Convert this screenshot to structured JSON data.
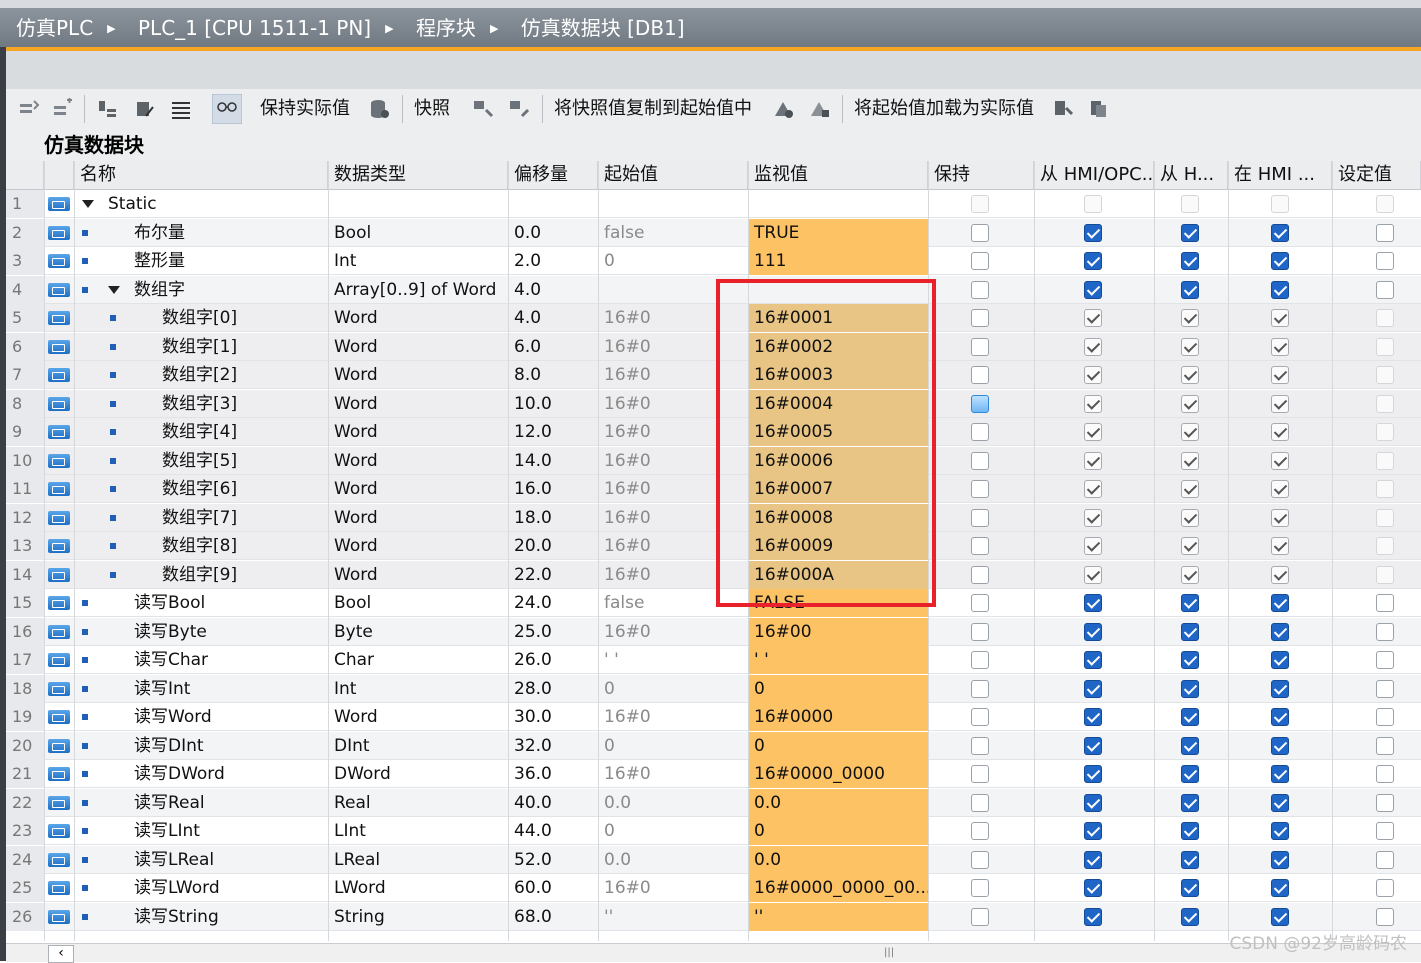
{
  "breadcrumb": [
    "仿真PLC",
    "PLC_1 [CPU 1511-1 PN]",
    "程序块",
    "仿真数据块 [DB1]"
  ],
  "toolbar": {
    "keep_actual": "保持实际值",
    "snapshot": "快照",
    "copy_snapshot_to_start": "将快照值复制到起始值中",
    "load_start_as_actual": "将起始值加载为实际值"
  },
  "block_title": "仿真数据块",
  "columns": {
    "name": "名称",
    "datatype": "数据类型",
    "offset": "偏移量",
    "start": "起始值",
    "monitor": "监视值",
    "retain": "保持",
    "from_hmi": "从 HMI/OPC...",
    "from_h": "从 H...",
    "in_hmi": "在 HMI ...",
    "setpoint": "设定值"
  },
  "rows": [
    {
      "n": "1",
      "name": "Static",
      "type": "",
      "offset": "",
      "start": "",
      "monitor": "",
      "level": 0,
      "expander": true,
      "group": true,
      "cb": [
        "faint",
        "faint",
        "faint",
        "faint",
        "faint"
      ]
    },
    {
      "n": "2",
      "name": "布尔量",
      "type": "Bool",
      "offset": "0.0",
      "start": "false",
      "monitor": "TRUE",
      "level": 1,
      "cb": [
        "none",
        "checked",
        "checked",
        "checked",
        "none"
      ]
    },
    {
      "n": "3",
      "name": "整形量",
      "type": "Int",
      "offset": "2.0",
      "start": "0",
      "monitor": "111",
      "level": 1,
      "cb": [
        "none",
        "checked",
        "checked",
        "checked",
        "none"
      ]
    },
    {
      "n": "4",
      "name": "数组字",
      "type": "Array[0..9] of Word",
      "offset": "4.0",
      "start": "",
      "monitor": "",
      "level": 1,
      "expander": true,
      "group": true,
      "cb": [
        "none",
        "checked",
        "checked",
        "checked",
        "none"
      ]
    },
    {
      "n": "5",
      "name": "数组字[0]",
      "type": "Word",
      "offset": "4.0",
      "start": "16#0",
      "monitor": "16#0001",
      "level": 2,
      "cb": [
        "none",
        "gray",
        "gray",
        "gray",
        "faint"
      ]
    },
    {
      "n": "6",
      "name": "数组字[1]",
      "type": "Word",
      "offset": "6.0",
      "start": "16#0",
      "monitor": "16#0002",
      "level": 2,
      "cb": [
        "none",
        "gray",
        "gray",
        "gray",
        "faint"
      ]
    },
    {
      "n": "7",
      "name": "数组字[2]",
      "type": "Word",
      "offset": "8.0",
      "start": "16#0",
      "monitor": "16#0003",
      "level": 2,
      "cb": [
        "none",
        "gray",
        "gray",
        "gray",
        "faint"
      ]
    },
    {
      "n": "8",
      "name": "数组字[3]",
      "type": "Word",
      "offset": "10.0",
      "start": "16#0",
      "monitor": "16#0004",
      "level": 2,
      "cb": [
        "blue",
        "gray",
        "gray",
        "gray",
        "faint"
      ]
    },
    {
      "n": "9",
      "name": "数组字[4]",
      "type": "Word",
      "offset": "12.0",
      "start": "16#0",
      "monitor": "16#0005",
      "level": 2,
      "cb": [
        "none",
        "gray",
        "gray",
        "gray",
        "faint"
      ]
    },
    {
      "n": "10",
      "name": "数组字[5]",
      "type": "Word",
      "offset": "14.0",
      "start": "16#0",
      "monitor": "16#0006",
      "level": 2,
      "cb": [
        "none",
        "gray",
        "gray",
        "gray",
        "faint"
      ]
    },
    {
      "n": "11",
      "name": "数组字[6]",
      "type": "Word",
      "offset": "16.0",
      "start": "16#0",
      "monitor": "16#0007",
      "level": 2,
      "cb": [
        "none",
        "gray",
        "gray",
        "gray",
        "faint"
      ]
    },
    {
      "n": "12",
      "name": "数组字[7]",
      "type": "Word",
      "offset": "18.0",
      "start": "16#0",
      "monitor": "16#0008",
      "level": 2,
      "cb": [
        "none",
        "gray",
        "gray",
        "gray",
        "faint"
      ]
    },
    {
      "n": "13",
      "name": "数组字[8]",
      "type": "Word",
      "offset": "20.0",
      "start": "16#0",
      "monitor": "16#0009",
      "level": 2,
      "cb": [
        "none",
        "gray",
        "gray",
        "gray",
        "faint"
      ]
    },
    {
      "n": "14",
      "name": "数组字[9]",
      "type": "Word",
      "offset": "22.0",
      "start": "16#0",
      "monitor": "16#000A",
      "level": 2,
      "cb": [
        "none",
        "gray",
        "gray",
        "gray",
        "faint"
      ]
    },
    {
      "n": "15",
      "name": "读写Bool",
      "type": "Bool",
      "offset": "24.0",
      "start": "false",
      "monitor": "FALSE",
      "level": 1,
      "cb": [
        "none",
        "checked",
        "checked",
        "checked",
        "none"
      ]
    },
    {
      "n": "16",
      "name": "读写Byte",
      "type": "Byte",
      "offset": "25.0",
      "start": "16#0",
      "monitor": "16#00",
      "level": 1,
      "cb": [
        "none",
        "checked",
        "checked",
        "checked",
        "none"
      ]
    },
    {
      "n": "17",
      "name": "读写Char",
      "type": "Char",
      "offset": "26.0",
      "start": "' '",
      "monitor": "' '",
      "level": 1,
      "cb": [
        "none",
        "checked",
        "checked",
        "checked",
        "none"
      ]
    },
    {
      "n": "18",
      "name": "读写Int",
      "type": "Int",
      "offset": "28.0",
      "start": "0",
      "monitor": "0",
      "level": 1,
      "cb": [
        "none",
        "checked",
        "checked",
        "checked",
        "none"
      ]
    },
    {
      "n": "19",
      "name": "读写Word",
      "type": "Word",
      "offset": "30.0",
      "start": "16#0",
      "monitor": "16#0000",
      "level": 1,
      "cb": [
        "none",
        "checked",
        "checked",
        "checked",
        "none"
      ]
    },
    {
      "n": "20",
      "name": "读写DInt",
      "type": "DInt",
      "offset": "32.0",
      "start": "0",
      "monitor": "0",
      "level": 1,
      "cb": [
        "none",
        "checked",
        "checked",
        "checked",
        "none"
      ]
    },
    {
      "n": "21",
      "name": "读写DWord",
      "type": "DWord",
      "offset": "36.0",
      "start": "16#0",
      "monitor": "16#0000_0000",
      "level": 1,
      "cb": [
        "none",
        "checked",
        "checked",
        "checked",
        "none"
      ]
    },
    {
      "n": "22",
      "name": "读写Real",
      "type": "Real",
      "offset": "40.0",
      "start": "0.0",
      "monitor": "0.0",
      "level": 1,
      "cb": [
        "none",
        "checked",
        "checked",
        "checked",
        "none"
      ]
    },
    {
      "n": "23",
      "name": "读写LInt",
      "type": "LInt",
      "offset": "44.0",
      "start": "0",
      "monitor": "0",
      "level": 1,
      "cb": [
        "none",
        "checked",
        "checked",
        "checked",
        "none"
      ]
    },
    {
      "n": "24",
      "name": "读写LReal",
      "type": "LReal",
      "offset": "52.0",
      "start": "0.0",
      "monitor": "0.0",
      "level": 1,
      "cb": [
        "none",
        "checked",
        "checked",
        "checked",
        "none"
      ]
    },
    {
      "n": "25",
      "name": "读写LWord",
      "type": "LWord",
      "offset": "60.0",
      "start": "16#0",
      "monitor": "16#0000_0000_00...",
      "level": 1,
      "cb": [
        "none",
        "checked",
        "checked",
        "checked",
        "none"
      ]
    },
    {
      "n": "26",
      "name": "读写String",
      "type": "String",
      "offset": "68.0",
      "start": "''",
      "monitor": "''",
      "level": 1,
      "cb": [
        "none",
        "checked",
        "checked",
        "checked",
        "none"
      ]
    }
  ],
  "watermark": "CSDN @92岁高龄码农",
  "colors": {
    "accent": "#f6a623",
    "monitor_bg": "#fdc263",
    "highlight_box": "#e8212a",
    "checkbox": "#1f66c7"
  }
}
